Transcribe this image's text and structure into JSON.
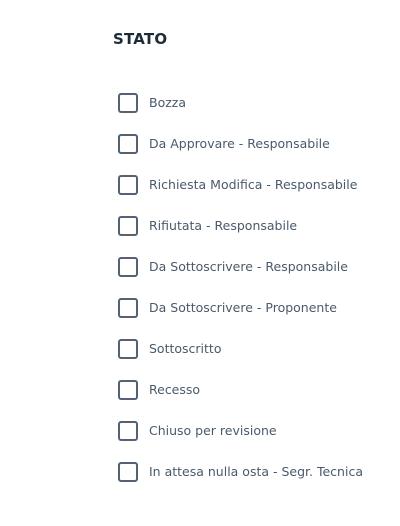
{
  "filter": {
    "title": "STATO",
    "options": [
      {
        "label": "Bozza",
        "checked": false
      },
      {
        "label": "Da Approvare - Responsabile",
        "checked": false
      },
      {
        "label": "Richiesta Modifica - Responsabile",
        "checked": false
      },
      {
        "label": "Rifiutata - Responsabile",
        "checked": false
      },
      {
        "label": "Da Sottoscrivere - Responsabile",
        "checked": false
      },
      {
        "label": "Da Sottoscrivere - Proponente",
        "checked": false
      },
      {
        "label": "Sottoscritto",
        "checked": false
      },
      {
        "label": "Recesso",
        "checked": false
      },
      {
        "label": "Chiuso per revisione",
        "checked": false
      },
      {
        "label": "In attesa nulla osta - Segr. Tecnica",
        "checked": false
      }
    ]
  },
  "colors": {
    "title": "#1d2b36",
    "checkbox_border": "#556273",
    "label": "#4a5a6b"
  }
}
